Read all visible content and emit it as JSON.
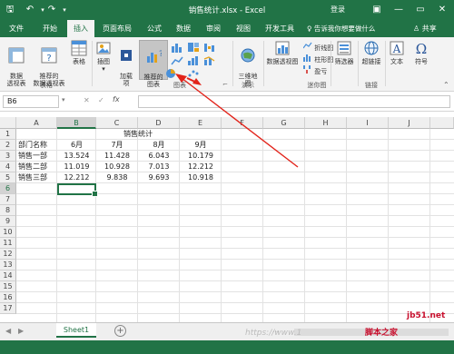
{
  "titlebar": {
    "title": "销售统计.xlsx - Excel",
    "login": "登录",
    "save_icon": "save-icon",
    "undo_icon": "undo-icon",
    "redo_icon": "redo-icon",
    "minimize": "—",
    "restore": "▭",
    "close": "✕",
    "ribbon_display": "▣",
    "undo": "↶",
    "redo": "↷",
    "save": "🖫",
    "customize": "▾"
  },
  "tabs": [
    {
      "label": "文件"
    },
    {
      "label": "开始"
    },
    {
      "label": "插入"
    },
    {
      "label": "页面布局"
    },
    {
      "label": "公式"
    },
    {
      "label": "数据"
    },
    {
      "label": "审阅"
    },
    {
      "label": "视图"
    },
    {
      "label": "开发工具"
    }
  ],
  "tellme": "♀ 告诉我你想要做什么",
  "share": "♙ 共享",
  "ribbon": {
    "pivot": "数据\n透视表",
    "rec_pivot": "推荐的\n数据透视表",
    "table": "表格",
    "illustrations": "插图",
    "addins": "加载\n项",
    "rec_charts": "推荐的\n图表",
    "map3d": "三维地\n图",
    "pivotchart": "数据透视图",
    "line": "折线图",
    "column": "柱形图",
    "winloss": "盈亏",
    "slicer": "筛选器",
    "hyperlink": "超链接",
    "text": "文本",
    "symbol": "符号",
    "group_tables": "表格",
    "group_charts": "图表",
    "group_tours": "演示",
    "group_sparklines": "迷你图",
    "group_links": "链接",
    "dropdown": "▾",
    "launcher": "⌐"
  },
  "formula_bar": {
    "namebox": "B6",
    "fx": "fx",
    "cancel": "✕",
    "enter": "✓",
    "value": ""
  },
  "columns": [
    "A",
    "B",
    "C",
    "D",
    "E",
    "F",
    "G",
    "H",
    "I",
    "J"
  ],
  "rows": [
    "1",
    "2",
    "3",
    "4",
    "5",
    "6",
    "7",
    "8",
    "9",
    "10",
    "11",
    "12",
    "13",
    "14",
    "15",
    "16",
    "17"
  ],
  "sheet": {
    "title": "销售统计",
    "header": [
      "部门名称",
      "6月",
      "7月",
      "8月",
      "9月"
    ],
    "data": [
      [
        "销售一部",
        "13.524",
        "11.428",
        "6.043",
        "10.179"
      ],
      [
        "销售二部",
        "11.019",
        "10.928",
        "7.013",
        "12.212"
      ],
      [
        "销售三部",
        "12.212",
        "9.838",
        "9.693",
        "10.918"
      ]
    ]
  },
  "sheet_tabs": {
    "active": "Sheet1",
    "add": "+",
    "prev": "◀",
    "next": "▶",
    "more": "..."
  },
  "watermark": {
    "site": "jb51.net",
    "brand": "脚本之家",
    "url": "https://www.1"
  },
  "colors": {
    "excel_green": "#217346",
    "arrow_red": "#e2231a"
  }
}
